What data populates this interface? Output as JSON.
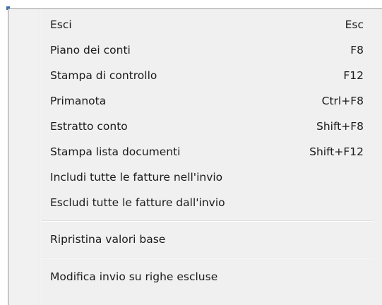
{
  "menu": {
    "group1": [
      {
        "label": "Esci",
        "shortcut": "Esc"
      },
      {
        "label": "Piano dei conti",
        "shortcut": "F8"
      },
      {
        "label": "Stampa di controllo",
        "shortcut": "F12"
      },
      {
        "label": "Primanota",
        "shortcut": "Ctrl+F8"
      },
      {
        "label": "Estratto conto",
        "shortcut": "Shift+F8"
      },
      {
        "label": "Stampa lista documenti",
        "shortcut": "Shift+F12"
      },
      {
        "label": "Includi tutte le fatture nell'invio",
        "shortcut": ""
      },
      {
        "label": "Escludi tutte le fatture dall'invio",
        "shortcut": ""
      }
    ],
    "group2": [
      {
        "label": "Ripristina valori base",
        "shortcut": ""
      }
    ],
    "group3": [
      {
        "label": "Modifica invio su righe escluse",
        "shortcut": ""
      }
    ]
  },
  "colors": {
    "menu_background": "#f0f0f0",
    "text": "#1a1a1a",
    "border": "#979797"
  }
}
